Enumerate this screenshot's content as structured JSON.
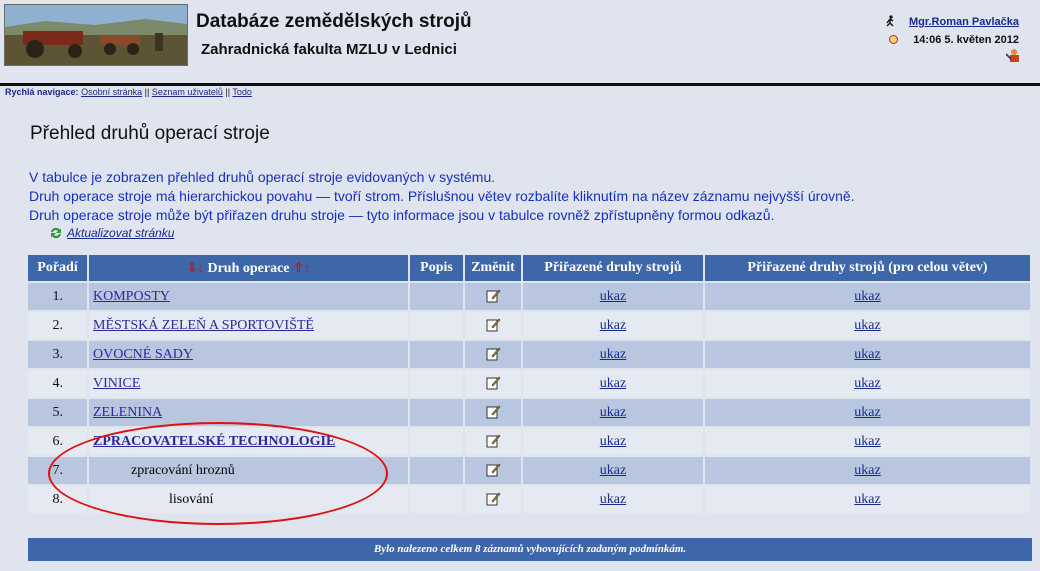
{
  "header": {
    "title": "Databáze zemědělských strojů",
    "subtitle": "Zahradnická fakulta MZLU v Lednici",
    "user_name": "Mgr.Roman Pavlačka",
    "datetime": "14:06  5. květen 2012"
  },
  "quicknav": {
    "label": "Rychlá navigace:",
    "links": [
      "Osobní stránka",
      "Seznam uživatelů",
      "Todo"
    ],
    "separator": "||"
  },
  "page": {
    "title": "Přehled druhů operací stroje",
    "intro": [
      "V tabulce je zobrazen přehled druhů operací stroje evidovaných v systému.",
      "Druh operace stroje má hierarchickou povahu — tvoří strom. Příslušnou větev rozbalíte kliknutím na název záznamu nejvyšší úrovně.",
      "Druh operace stroje může být přiřazen druhu stroje — tyto informace jsou v tabulce rovněž zpřístupněny formou odkazů."
    ],
    "refresh_label": "Aktualizovat stránku"
  },
  "table": {
    "headers": {
      "order": "Pořadí",
      "name": "Druh operace",
      "desc": "Popis",
      "edit": "Změnit",
      "assigned": "Přiřazené druhy strojů",
      "assigned_branch": "Přiřazené druhy strojů (pro celou větev)"
    },
    "rows": [
      {
        "order": "1.",
        "name": "KOMPOSTY",
        "link1": "ukaz",
        "link2": "ukaz"
      },
      {
        "order": "2.",
        "name": "MĚSTSKÁ ZELEŇ A SPORTOVIŠTĚ",
        "link1": "ukaz",
        "link2": "ukaz"
      },
      {
        "order": "3.",
        "name": "OVOCNÉ SADY",
        "link1": "ukaz",
        "link2": "ukaz"
      },
      {
        "order": "4.",
        "name": "VINICE",
        "link1": "ukaz",
        "link2": "ukaz"
      },
      {
        "order": "5.",
        "name": "ZELENINA",
        "link1": "ukaz",
        "link2": "ukaz"
      },
      {
        "order": "6.",
        "name": "ZPRACOVATELSKÉ TECHNOLOGIE",
        "link1": "ukaz",
        "link2": "ukaz"
      },
      {
        "order": "7.",
        "name": "zpracování hroznů",
        "link1": "ukaz",
        "link2": "ukaz"
      },
      {
        "order": "8.",
        "name": "lisování",
        "link1": "ukaz",
        "link2": "ukaz"
      }
    ],
    "footer": "Bylo nalezeno celkem 8 záznamů vyhovujících zadaným podmínkám."
  },
  "colors": {
    "header_bg": "#3e67a9",
    "row_odd": "#b8c7df",
    "row_even": "#e5e9f1",
    "annotation": "#e01010"
  }
}
